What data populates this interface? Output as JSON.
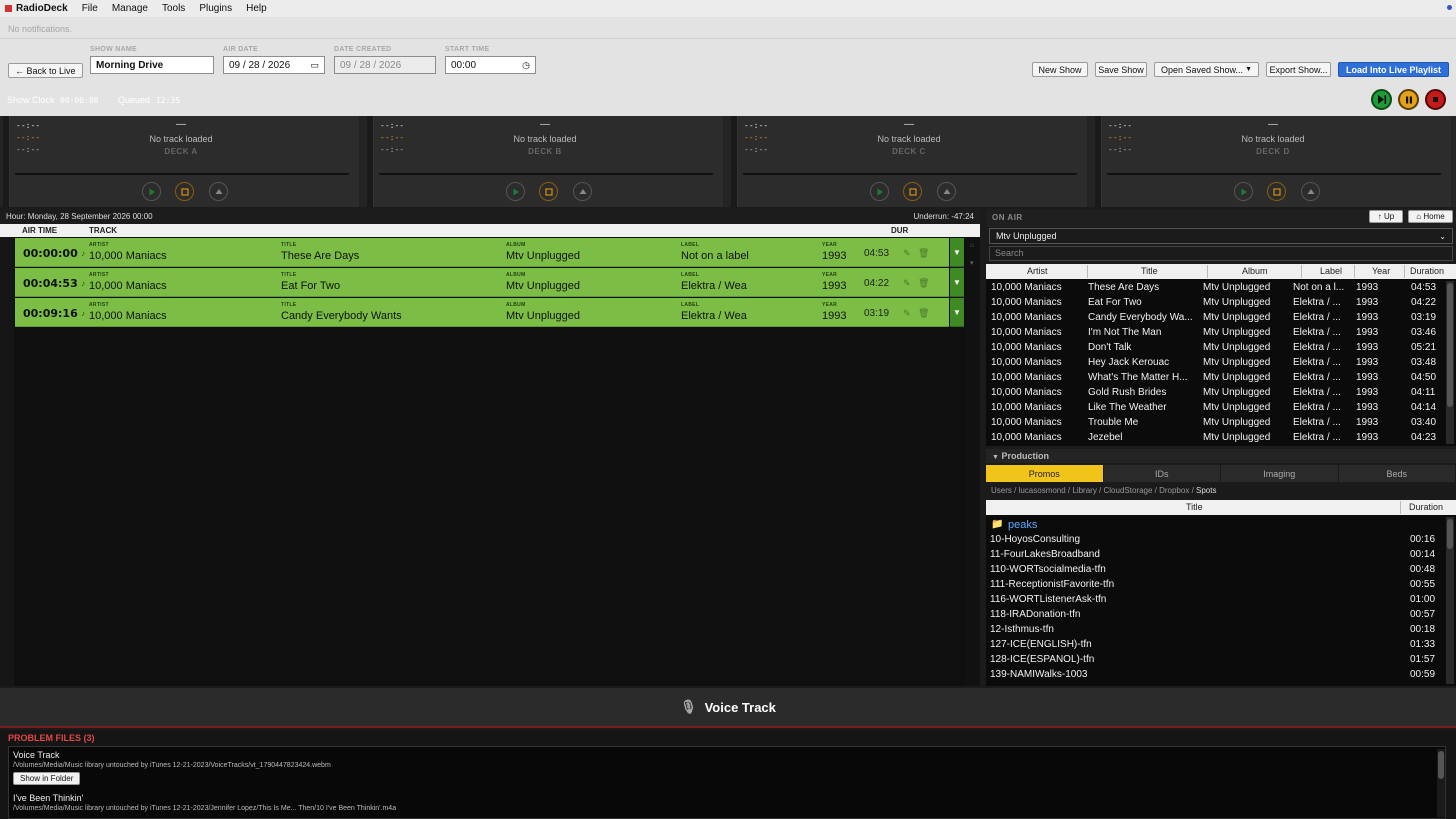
{
  "app": {
    "name": "RadioDeck",
    "menus": [
      "File",
      "Manage",
      "Tools",
      "Plugins",
      "Help"
    ],
    "notification": "No notifications."
  },
  "show": {
    "back_label": "← Back to Live",
    "show_name_label": "SHOW NAME",
    "show_name": "Morning Drive",
    "air_date_label": "AIR DATE",
    "air_date": "09 / 28 / 2026",
    "date_created_label": "DATE CREATED",
    "date_created": "09 / 28 / 2026",
    "start_time_label": "START TIME",
    "start_time": "00:00",
    "buttons": {
      "new": "New Show",
      "save": "Save Show",
      "open": "Open Saved Show...",
      "export": "Export Show...",
      "load": "Load Into Live Playlist"
    }
  },
  "clock": {
    "show_clock_label": "Show Clock",
    "show_clock": "00:00:00",
    "queued_label": "Queued",
    "queued": "12:35"
  },
  "decks": [
    {
      "name": "DECK A",
      "status": "No track loaded",
      "title": "—",
      "elapsed": "--:--",
      "remaining": "--:--",
      "total": "--:--"
    },
    {
      "name": "DECK B",
      "status": "No track loaded",
      "title": "—",
      "elapsed": "--:--",
      "remaining": "--:--",
      "total": "--:--"
    },
    {
      "name": "DECK C",
      "status": "No track loaded",
      "title": "—",
      "elapsed": "--:--",
      "remaining": "--:--",
      "total": "--:--"
    },
    {
      "name": "DECK D",
      "status": "No track loaded",
      "title": "—",
      "elapsed": "--:--",
      "remaining": "--:--",
      "total": "--:--"
    }
  ],
  "playlist": {
    "hour": "Hour: Monday, 28 September 2026 00:00",
    "underrun": "Underrun: -47:24",
    "columns": {
      "air_time": "AIR TIME",
      "track": "TRACK",
      "dur": "DUR"
    },
    "field_labels": {
      "artist": "ARTIST",
      "title": "TITLE",
      "album": "ALBUM",
      "label": "LABEL",
      "year": "YEAR"
    },
    "rows": [
      {
        "time": "00:00:00",
        "artist": "10,000 Maniacs",
        "title": "These Are Days",
        "album": "Mtv Unplugged",
        "label": "Not on a label",
        "year": "1993",
        "dur": "04:53"
      },
      {
        "time": "00:04:53",
        "artist": "10,000 Maniacs",
        "title": "Eat For Two",
        "album": "Mtv Unplugged",
        "label": "Elektra / Wea",
        "year": "1993",
        "dur": "04:22"
      },
      {
        "time": "00:09:16",
        "artist": "10,000 Maniacs",
        "title": "Candy Everybody Wants",
        "album": "Mtv Unplugged",
        "label": "Elektra / Wea",
        "year": "1993",
        "dur": "03:19"
      }
    ]
  },
  "library": {
    "on_air_label": "ON AIR",
    "up_label": "↑ Up",
    "home_label": "⌂ Home",
    "selected_album": "Mtv Unplugged",
    "search_placeholder": "Search",
    "columns": [
      "Artist",
      "Title",
      "Album",
      "Label",
      "Year",
      "Duration"
    ],
    "rows": [
      {
        "artist": "10,000 Maniacs",
        "title": "These Are Days",
        "album": "Mtv Unplugged",
        "label": "Not on a l...",
        "year": "1993",
        "dur": "04:53"
      },
      {
        "artist": "10,000 Maniacs",
        "title": "Eat For Two",
        "album": "Mtv Unplugged",
        "label": "Elektra / ...",
        "year": "1993",
        "dur": "04:22"
      },
      {
        "artist": "10,000 Maniacs",
        "title": "Candy Everybody Wa...",
        "album": "Mtv Unplugged",
        "label": "Elektra / ...",
        "year": "1993",
        "dur": "03:19"
      },
      {
        "artist": "10,000 Maniacs",
        "title": "I'm Not The Man",
        "album": "Mtv Unplugged",
        "label": "Elektra / ...",
        "year": "1993",
        "dur": "03:46"
      },
      {
        "artist": "10,000 Maniacs",
        "title": "Don't Talk",
        "album": "Mtv Unplugged",
        "label": "Elektra / ...",
        "year": "1993",
        "dur": "05:21"
      },
      {
        "artist": "10,000 Maniacs",
        "title": "Hey Jack Kerouac",
        "album": "Mtv Unplugged",
        "label": "Elektra / ...",
        "year": "1993",
        "dur": "03:48"
      },
      {
        "artist": "10,000 Maniacs",
        "title": "What's The Matter H...",
        "album": "Mtv Unplugged",
        "label": "Elektra / ...",
        "year": "1993",
        "dur": "04:50"
      },
      {
        "artist": "10,000 Maniacs",
        "title": "Gold Rush Brides",
        "album": "Mtv Unplugged",
        "label": "Elektra / ...",
        "year": "1993",
        "dur": "04:11"
      },
      {
        "artist": "10,000 Maniacs",
        "title": "Like The Weather",
        "album": "Mtv Unplugged",
        "label": "Elektra / ...",
        "year": "1993",
        "dur": "04:14"
      },
      {
        "artist": "10,000 Maniacs",
        "title": "Trouble Me",
        "album": "Mtv Unplugged",
        "label": "Elektra / ...",
        "year": "1993",
        "dur": "03:40"
      },
      {
        "artist": "10,000 Maniacs",
        "title": "Jezebel",
        "album": "Mtv Unplugged",
        "label": "Elektra / ...",
        "year": "1993",
        "dur": "04:23"
      }
    ]
  },
  "production": {
    "header": "Production",
    "tabs": [
      "Promos",
      "IDs",
      "Imaging",
      "Beds"
    ],
    "active_tab": "Promos",
    "path": [
      "Users",
      "lucasosmond",
      "Library",
      "CloudStorage",
      "Dropbox",
      "Spots"
    ],
    "columns": {
      "title": "Title",
      "duration": "Duration"
    },
    "folder": "peaks",
    "rows": [
      {
        "title": "10-HoyosConsulting",
        "dur": "00:16"
      },
      {
        "title": "11-FourLakesBroadband",
        "dur": "00:14"
      },
      {
        "title": "110-WORTsocialmedia-tfn",
        "dur": "00:48"
      },
      {
        "title": "111-ReceptionistFavorite-tfn",
        "dur": "00:55"
      },
      {
        "title": "116-WORTListenerAsk-tfn",
        "dur": "01:00"
      },
      {
        "title": "118-IRADonation-tfn",
        "dur": "00:57"
      },
      {
        "title": "12-Isthmus-tfn",
        "dur": "00:18"
      },
      {
        "title": "127-ICE(ENGLISH)-tfn",
        "dur": "01:33"
      },
      {
        "title": "128-ICE(ESPANOL)-tfn",
        "dur": "01:57"
      },
      {
        "title": "139-NAMIWalks-1003",
        "dur": "00:59"
      }
    ]
  },
  "voice_track": {
    "label": "Voice Track"
  },
  "problems": {
    "header": "PROBLEM FILES (3)",
    "show_in_folder": "Show in Folder",
    "items": [
      {
        "title": "Voice Track",
        "path": "/Volumes/Media/Music library untouched by iTunes 12-21-2023/VoiceTracks/vt_1790447823424.webm"
      },
      {
        "title": "I've Been Thinkin'",
        "path": "/Volumes/Media/Music library untouched by iTunes 12-21-2023/Jennifer Lopez/This Is Me... Then/10 I've Been Thinkin'.m4a"
      }
    ]
  }
}
